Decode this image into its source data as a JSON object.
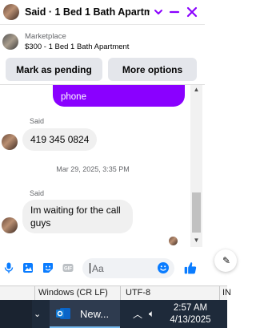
{
  "chat": {
    "title": "Said · 1 Bed 1 Bath Apartm...",
    "header_icons": [
      "chevron-down-icon",
      "minimize-icon",
      "close-icon"
    ],
    "listing": {
      "category": "Marketplace",
      "item": "$300 - 1 Bed 1 Bath Apartment"
    },
    "actions": {
      "mark_pending": "Mark as pending",
      "more_options": "More options"
    },
    "messages": [
      {
        "from": "me",
        "text": "phone"
      },
      {
        "from": "Said",
        "sender": "Said",
        "text": "419 345 0824"
      },
      {
        "type": "timestamp",
        "text": "Mar 29, 2025, 3:35 PM"
      },
      {
        "from": "Said",
        "sender": "Said",
        "text": "Im waiting for the call guys"
      }
    ],
    "composer": {
      "placeholder": "Aa",
      "icons": [
        "microphone-icon",
        "photo-icon",
        "sticker-icon",
        "gif-icon",
        "emoji-icon",
        "like-icon"
      ]
    },
    "accent_color": "#8a00ff",
    "brand_color": "#0a7cff"
  },
  "statusbar": {
    "line_ending": "Windows (CR LF)",
    "encoding": "UTF-8",
    "extra": "IN"
  },
  "taskbar": {
    "app_label": "New...",
    "time": "2:57 AM",
    "date": "4/13/2025"
  }
}
